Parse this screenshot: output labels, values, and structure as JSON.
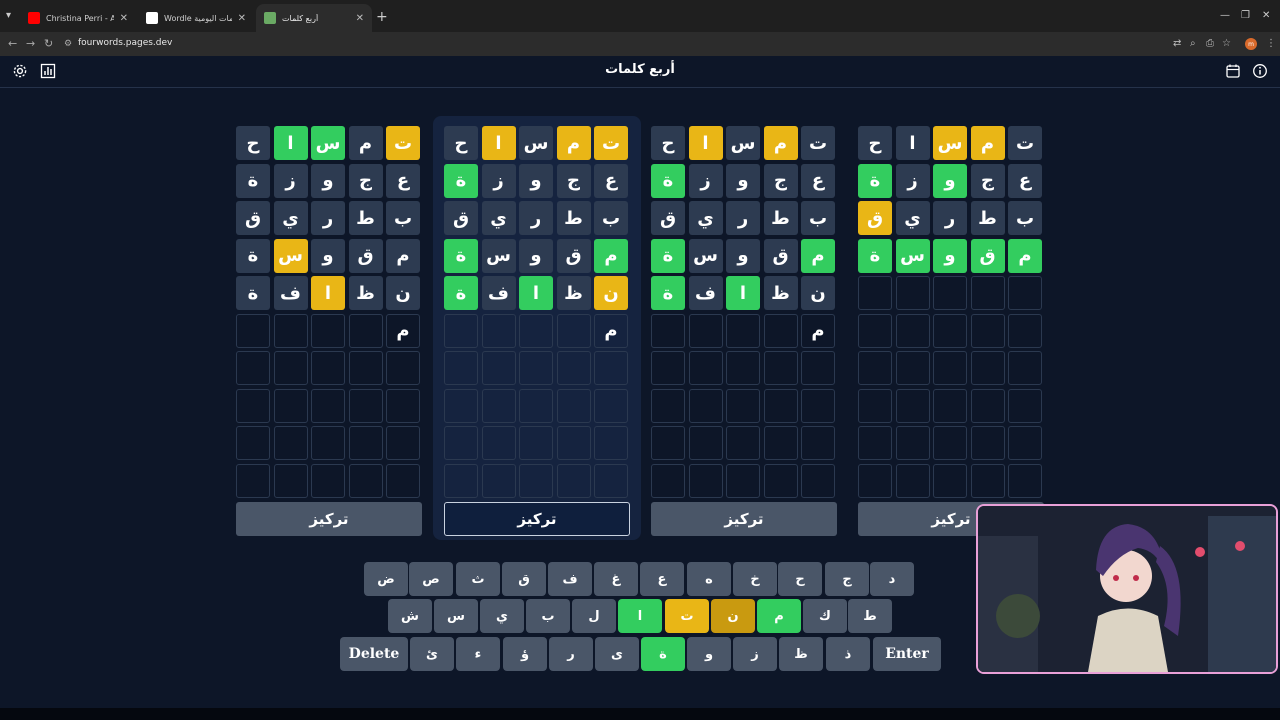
{
  "browser": {
    "tabs": [
      {
        "title": "Christina Perri - A Thousand Years",
        "fav_color": "#ff0000",
        "active": false
      },
      {
        "title": "Wordle لعبة الكلمات اليومية",
        "fav_color": "#ffffff",
        "active": false
      },
      {
        "title": "أربع كلمات",
        "fav_color": "#6aaa64",
        "active": true
      }
    ],
    "new_tab": "+",
    "url": "fourwords.pages.dev",
    "profile_initials": "m"
  },
  "app": {
    "title": "أربع كلمات",
    "icons": {
      "settings": "gear-icon",
      "stats": "bar-chart-icon",
      "calendar": "calendar-icon",
      "info": "info-icon"
    }
  },
  "colors": {
    "correct": "#33cd5f",
    "present": "#e9b616",
    "absent": "#2d3b51",
    "key": "#4a5668",
    "background": "#0d1628"
  },
  "boards": [
    {
      "selected": false,
      "focus_label": "تركيز",
      "rows": [
        [
          {
            "l": "ت",
            "s": "y"
          },
          {
            "l": "م",
            "s": "a"
          },
          {
            "l": "س",
            "s": "g"
          },
          {
            "l": "ا",
            "s": "g"
          },
          {
            "l": "ح",
            "s": "a"
          }
        ],
        [
          {
            "l": "ع",
            "s": "a"
          },
          {
            "l": "ج",
            "s": "a"
          },
          {
            "l": "و",
            "s": "a"
          },
          {
            "l": "ز",
            "s": "a"
          },
          {
            "l": "ة",
            "s": "a"
          }
        ],
        [
          {
            "l": "ب",
            "s": "a"
          },
          {
            "l": "ط",
            "s": "a"
          },
          {
            "l": "ر",
            "s": "a"
          },
          {
            "l": "ي",
            "s": "a"
          },
          {
            "l": "ق",
            "s": "a"
          }
        ],
        [
          {
            "l": "م",
            "s": "a"
          },
          {
            "l": "ق",
            "s": "a"
          },
          {
            "l": "و",
            "s": "a"
          },
          {
            "l": "س",
            "s": "y"
          },
          {
            "l": "ة",
            "s": "a"
          }
        ],
        [
          {
            "l": "ن",
            "s": "a"
          },
          {
            "l": "ظ",
            "s": "a"
          },
          {
            "l": "ا",
            "s": "y"
          },
          {
            "l": "ف",
            "s": "a"
          },
          {
            "l": "ة",
            "s": "a"
          }
        ],
        [
          {
            "l": "م",
            "s": "e"
          },
          {
            "l": "",
            "s": "e"
          },
          {
            "l": "",
            "s": "e"
          },
          {
            "l": "",
            "s": "e"
          },
          {
            "l": "",
            "s": "e"
          }
        ],
        [
          {
            "l": "",
            "s": "e"
          },
          {
            "l": "",
            "s": "e"
          },
          {
            "l": "",
            "s": "e"
          },
          {
            "l": "",
            "s": "e"
          },
          {
            "l": "",
            "s": "e"
          }
        ],
        [
          {
            "l": "",
            "s": "e"
          },
          {
            "l": "",
            "s": "e"
          },
          {
            "l": "",
            "s": "e"
          },
          {
            "l": "",
            "s": "e"
          },
          {
            "l": "",
            "s": "e"
          }
        ],
        [
          {
            "l": "",
            "s": "e"
          },
          {
            "l": "",
            "s": "e"
          },
          {
            "l": "",
            "s": "e"
          },
          {
            "l": "",
            "s": "e"
          },
          {
            "l": "",
            "s": "e"
          }
        ],
        [
          {
            "l": "",
            "s": "e"
          },
          {
            "l": "",
            "s": "e"
          },
          {
            "l": "",
            "s": "e"
          },
          {
            "l": "",
            "s": "e"
          },
          {
            "l": "",
            "s": "e"
          }
        ]
      ]
    },
    {
      "selected": true,
      "focus_label": "تركيز",
      "rows": [
        [
          {
            "l": "ت",
            "s": "y"
          },
          {
            "l": "م",
            "s": "y"
          },
          {
            "l": "س",
            "s": "a"
          },
          {
            "l": "ا",
            "s": "y"
          },
          {
            "l": "ح",
            "s": "a"
          }
        ],
        [
          {
            "l": "ع",
            "s": "a"
          },
          {
            "l": "ج",
            "s": "a"
          },
          {
            "l": "و",
            "s": "a"
          },
          {
            "l": "ز",
            "s": "a"
          },
          {
            "l": "ة",
            "s": "g"
          }
        ],
        [
          {
            "l": "ب",
            "s": "a"
          },
          {
            "l": "ط",
            "s": "a"
          },
          {
            "l": "ر",
            "s": "a"
          },
          {
            "l": "ي",
            "s": "a"
          },
          {
            "l": "ق",
            "s": "a"
          }
        ],
        [
          {
            "l": "م",
            "s": "g"
          },
          {
            "l": "ق",
            "s": "a"
          },
          {
            "l": "و",
            "s": "a"
          },
          {
            "l": "س",
            "s": "a"
          },
          {
            "l": "ة",
            "s": "g"
          }
        ],
        [
          {
            "l": "ن",
            "s": "y"
          },
          {
            "l": "ظ",
            "s": "a"
          },
          {
            "l": "ا",
            "s": "g"
          },
          {
            "l": "ف",
            "s": "a"
          },
          {
            "l": "ة",
            "s": "g"
          }
        ],
        [
          {
            "l": "م",
            "s": "e"
          },
          {
            "l": "",
            "s": "e"
          },
          {
            "l": "",
            "s": "e"
          },
          {
            "l": "",
            "s": "e"
          },
          {
            "l": "",
            "s": "e"
          }
        ],
        [
          {
            "l": "",
            "s": "e"
          },
          {
            "l": "",
            "s": "e"
          },
          {
            "l": "",
            "s": "e"
          },
          {
            "l": "",
            "s": "e"
          },
          {
            "l": "",
            "s": "e"
          }
        ],
        [
          {
            "l": "",
            "s": "e"
          },
          {
            "l": "",
            "s": "e"
          },
          {
            "l": "",
            "s": "e"
          },
          {
            "l": "",
            "s": "e"
          },
          {
            "l": "",
            "s": "e"
          }
        ],
        [
          {
            "l": "",
            "s": "e"
          },
          {
            "l": "",
            "s": "e"
          },
          {
            "l": "",
            "s": "e"
          },
          {
            "l": "",
            "s": "e"
          },
          {
            "l": "",
            "s": "e"
          }
        ],
        [
          {
            "l": "",
            "s": "e"
          },
          {
            "l": "",
            "s": "e"
          },
          {
            "l": "",
            "s": "e"
          },
          {
            "l": "",
            "s": "e"
          },
          {
            "l": "",
            "s": "e"
          }
        ]
      ]
    },
    {
      "selected": false,
      "focus_label": "تركيز",
      "rows": [
        [
          {
            "l": "ت",
            "s": "a"
          },
          {
            "l": "م",
            "s": "y"
          },
          {
            "l": "س",
            "s": "a"
          },
          {
            "l": "ا",
            "s": "y"
          },
          {
            "l": "ح",
            "s": "a"
          }
        ],
        [
          {
            "l": "ع",
            "s": "a"
          },
          {
            "l": "ج",
            "s": "a"
          },
          {
            "l": "و",
            "s": "a"
          },
          {
            "l": "ز",
            "s": "a"
          },
          {
            "l": "ة",
            "s": "g"
          }
        ],
        [
          {
            "l": "ب",
            "s": "a"
          },
          {
            "l": "ط",
            "s": "a"
          },
          {
            "l": "ر",
            "s": "a"
          },
          {
            "l": "ي",
            "s": "a"
          },
          {
            "l": "ق",
            "s": "a"
          }
        ],
        [
          {
            "l": "م",
            "s": "g"
          },
          {
            "l": "ق",
            "s": "a"
          },
          {
            "l": "و",
            "s": "a"
          },
          {
            "l": "س",
            "s": "a"
          },
          {
            "l": "ة",
            "s": "g"
          }
        ],
        [
          {
            "l": "ن",
            "s": "a"
          },
          {
            "l": "ظ",
            "s": "a"
          },
          {
            "l": "ا",
            "s": "g"
          },
          {
            "l": "ف",
            "s": "a"
          },
          {
            "l": "ة",
            "s": "g"
          }
        ],
        [
          {
            "l": "م",
            "s": "e"
          },
          {
            "l": "",
            "s": "e"
          },
          {
            "l": "",
            "s": "e"
          },
          {
            "l": "",
            "s": "e"
          },
          {
            "l": "",
            "s": "e"
          }
        ],
        [
          {
            "l": "",
            "s": "e"
          },
          {
            "l": "",
            "s": "e"
          },
          {
            "l": "",
            "s": "e"
          },
          {
            "l": "",
            "s": "e"
          },
          {
            "l": "",
            "s": "e"
          }
        ],
        [
          {
            "l": "",
            "s": "e"
          },
          {
            "l": "",
            "s": "e"
          },
          {
            "l": "",
            "s": "e"
          },
          {
            "l": "",
            "s": "e"
          },
          {
            "l": "",
            "s": "e"
          }
        ],
        [
          {
            "l": "",
            "s": "e"
          },
          {
            "l": "",
            "s": "e"
          },
          {
            "l": "",
            "s": "e"
          },
          {
            "l": "",
            "s": "e"
          },
          {
            "l": "",
            "s": "e"
          }
        ],
        [
          {
            "l": "",
            "s": "e"
          },
          {
            "l": "",
            "s": "e"
          },
          {
            "l": "",
            "s": "e"
          },
          {
            "l": "",
            "s": "e"
          },
          {
            "l": "",
            "s": "e"
          }
        ]
      ]
    },
    {
      "selected": false,
      "focus_label": "تركيز",
      "rows": [
        [
          {
            "l": "ت",
            "s": "a"
          },
          {
            "l": "م",
            "s": "y"
          },
          {
            "l": "س",
            "s": "y"
          },
          {
            "l": "ا",
            "s": "a"
          },
          {
            "l": "ح",
            "s": "a"
          }
        ],
        [
          {
            "l": "ع",
            "s": "a"
          },
          {
            "l": "ج",
            "s": "a"
          },
          {
            "l": "و",
            "s": "g"
          },
          {
            "l": "ز",
            "s": "a"
          },
          {
            "l": "ة",
            "s": "g"
          }
        ],
        [
          {
            "l": "ب",
            "s": "a"
          },
          {
            "l": "ط",
            "s": "a"
          },
          {
            "l": "ر",
            "s": "a"
          },
          {
            "l": "ي",
            "s": "a"
          },
          {
            "l": "ق",
            "s": "y"
          }
        ],
        [
          {
            "l": "م",
            "s": "g"
          },
          {
            "l": "ق",
            "s": "g"
          },
          {
            "l": "و",
            "s": "g"
          },
          {
            "l": "س",
            "s": "g"
          },
          {
            "l": "ة",
            "s": "g"
          }
        ],
        [
          {
            "l": "",
            "s": "e"
          },
          {
            "l": "",
            "s": "e"
          },
          {
            "l": "",
            "s": "e"
          },
          {
            "l": "",
            "s": "e"
          },
          {
            "l": "",
            "s": "e"
          }
        ],
        [
          {
            "l": "",
            "s": "e"
          },
          {
            "l": "",
            "s": "e"
          },
          {
            "l": "",
            "s": "e"
          },
          {
            "l": "",
            "s": "e"
          },
          {
            "l": "",
            "s": "e"
          }
        ],
        [
          {
            "l": "",
            "s": "e"
          },
          {
            "l": "",
            "s": "e"
          },
          {
            "l": "",
            "s": "e"
          },
          {
            "l": "",
            "s": "e"
          },
          {
            "l": "",
            "s": "e"
          }
        ],
        [
          {
            "l": "",
            "s": "e"
          },
          {
            "l": "",
            "s": "e"
          },
          {
            "l": "",
            "s": "e"
          },
          {
            "l": "",
            "s": "e"
          },
          {
            "l": "",
            "s": "e"
          }
        ],
        [
          {
            "l": "",
            "s": "e"
          },
          {
            "l": "",
            "s": "e"
          },
          {
            "l": "",
            "s": "e"
          },
          {
            "l": "",
            "s": "e"
          },
          {
            "l": "",
            "s": "e"
          }
        ],
        [
          {
            "l": "",
            "s": "e"
          },
          {
            "l": "",
            "s": "e"
          },
          {
            "l": "",
            "s": "e"
          },
          {
            "l": "",
            "s": "e"
          },
          {
            "l": "",
            "s": "e"
          }
        ]
      ]
    }
  ],
  "keyboard": {
    "rows": [
      [
        {
          "k": "د",
          "s": "a"
        },
        {
          "k": "ج",
          "s": "a"
        },
        {
          "k": "ح",
          "s": "a"
        },
        {
          "k": "خ",
          "s": "a"
        },
        {
          "k": "ه",
          "s": "a"
        },
        {
          "k": "ع",
          "s": "a"
        },
        {
          "k": "غ",
          "s": "a"
        },
        {
          "k": "ف",
          "s": "a"
        },
        {
          "k": "ق",
          "s": "a"
        },
        {
          "k": "ث",
          "s": "a"
        },
        {
          "k": "ص",
          "s": "a"
        },
        {
          "k": "ض",
          "s": "a"
        }
      ],
      [
        {
          "k": "ط",
          "s": "a"
        },
        {
          "k": "ك",
          "s": "a"
        },
        {
          "k": "م",
          "s": "g"
        },
        {
          "k": "ن",
          "s": "yd"
        },
        {
          "k": "ت",
          "s": "y"
        },
        {
          "k": "ا",
          "s": "g"
        },
        {
          "k": "ل",
          "s": "a"
        },
        {
          "k": "ب",
          "s": "a"
        },
        {
          "k": "ي",
          "s": "a"
        },
        {
          "k": "س",
          "s": "a"
        },
        {
          "k": "ش",
          "s": "a"
        }
      ],
      [
        {
          "k": "Enter",
          "s": "a",
          "wide": true
        },
        {
          "k": "ذ",
          "s": "a"
        },
        {
          "k": "ظ",
          "s": "a"
        },
        {
          "k": "ز",
          "s": "a"
        },
        {
          "k": "و",
          "s": "a"
        },
        {
          "k": "ة",
          "s": "g"
        },
        {
          "k": "ى",
          "s": "a"
        },
        {
          "k": "ر",
          "s": "a"
        },
        {
          "k": "ؤ",
          "s": "a"
        },
        {
          "k": "ء",
          "s": "a"
        },
        {
          "k": "ئ",
          "s": "a"
        },
        {
          "k": "Delete",
          "s": "a",
          "wide": true
        }
      ]
    ]
  }
}
